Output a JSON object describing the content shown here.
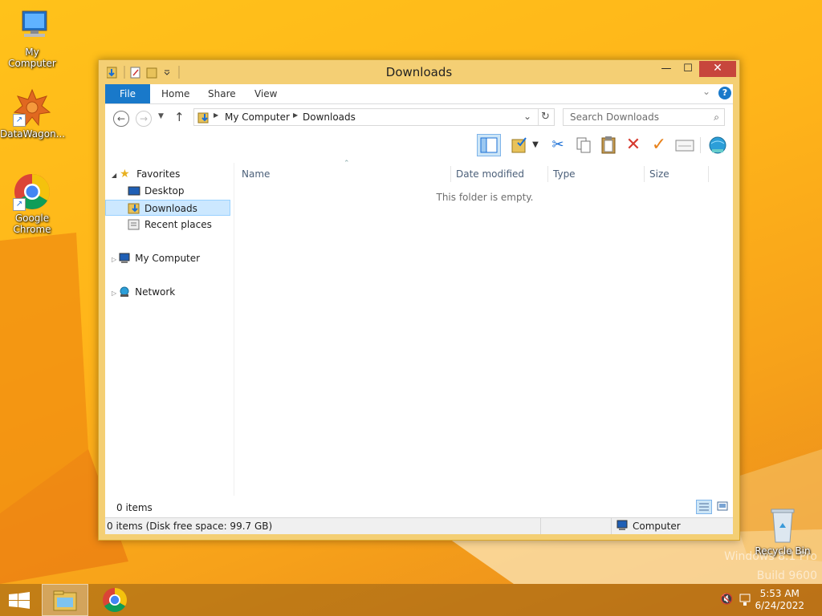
{
  "desktop": {
    "icons": [
      {
        "label": "My Computer"
      },
      {
        "label": "DataWagon..."
      },
      {
        "label": "Google Chrome"
      },
      {
        "label": "Recycle Bin"
      }
    ],
    "watermark_line1": "Windows 8.1 Pro",
    "watermark_line2": "Build 9600"
  },
  "window": {
    "title": "Downloads",
    "ribbon_tabs": [
      "File",
      "Home",
      "Share",
      "View"
    ],
    "address": {
      "segments": [
        "My Computer",
        "Downloads"
      ]
    },
    "search": {
      "placeholder": "Search Downloads"
    },
    "nav": {
      "favorites": "Favorites",
      "items": [
        "Desktop",
        "Downloads",
        "Recent places"
      ],
      "my_computer": "My Computer",
      "network": "Network"
    },
    "columns": [
      "Name",
      "Date modified",
      "Type",
      "Size"
    ],
    "empty_message": "This folder is empty.",
    "status": {
      "item_count": "0 items",
      "detail": "0 items (Disk free space: 99.7 GB)",
      "location": "Computer"
    }
  },
  "taskbar": {
    "time": "5:53 AM",
    "date": "6/24/2022"
  },
  "colors": {
    "accent": "#1979ca",
    "close": "#c7463c",
    "frame": "#f4cf74"
  }
}
